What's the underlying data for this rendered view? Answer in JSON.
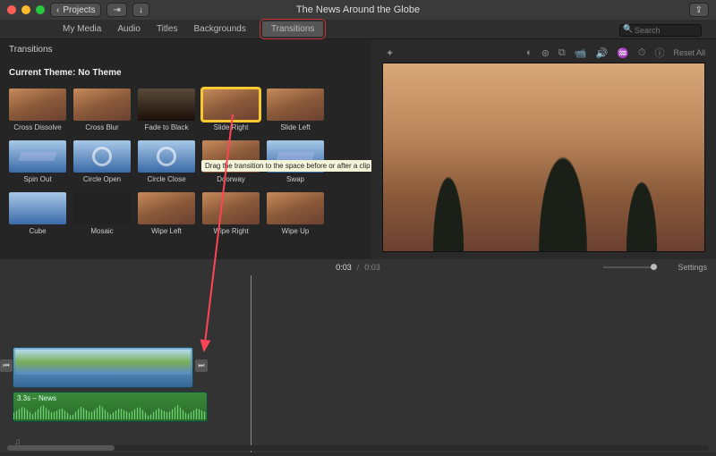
{
  "titlebar": {
    "back_label": "Projects",
    "title": "The News Around the Globe"
  },
  "tabs": {
    "items": [
      "My Media",
      "Audio",
      "Titles",
      "Backgrounds",
      "Transitions"
    ],
    "active_index": 4
  },
  "search": {
    "placeholder": "Search"
  },
  "browser": {
    "section": "Transitions",
    "theme_prefix": "Current Theme: ",
    "theme_value": "No Theme",
    "tooltip": "Drag the transition to the space before or after a clip",
    "items": [
      {
        "label": "Cross Dissolve",
        "sel": false,
        "variant": "orange"
      },
      {
        "label": "Cross Blur",
        "sel": false,
        "variant": "orange"
      },
      {
        "label": "Fade to Black",
        "sel": false,
        "variant": "dark"
      },
      {
        "label": "Slide Right",
        "sel": true,
        "variant": "orange"
      },
      {
        "label": "Slide Left",
        "sel": false,
        "variant": "orange"
      },
      {
        "label": "Spin Out",
        "sel": false,
        "variant": "blue"
      },
      {
        "label": "Circle Open",
        "sel": false,
        "variant": "blue"
      },
      {
        "label": "Circle Close",
        "sel": false,
        "variant": "blue"
      },
      {
        "label": "Doorway",
        "sel": false,
        "variant": "orange"
      },
      {
        "label": "Swap",
        "sel": false,
        "variant": "blue"
      },
      {
        "label": "Cube",
        "sel": false,
        "variant": "blue"
      },
      {
        "label": "Mosaic",
        "sel": false,
        "variant": "mosaic"
      },
      {
        "label": "Wipe Left",
        "sel": false,
        "variant": "orange"
      },
      {
        "label": "Wipe Right",
        "sel": false,
        "variant": "orange"
      },
      {
        "label": "Wipe Up",
        "sel": false,
        "variant": "orange"
      }
    ]
  },
  "preview_toolbar": {
    "reset": "Reset All"
  },
  "timeline_header": {
    "time_current": "0:03",
    "time_total": "0:03",
    "settings": "Settings"
  },
  "timeline": {
    "audio_label": "3.3s – News"
  }
}
